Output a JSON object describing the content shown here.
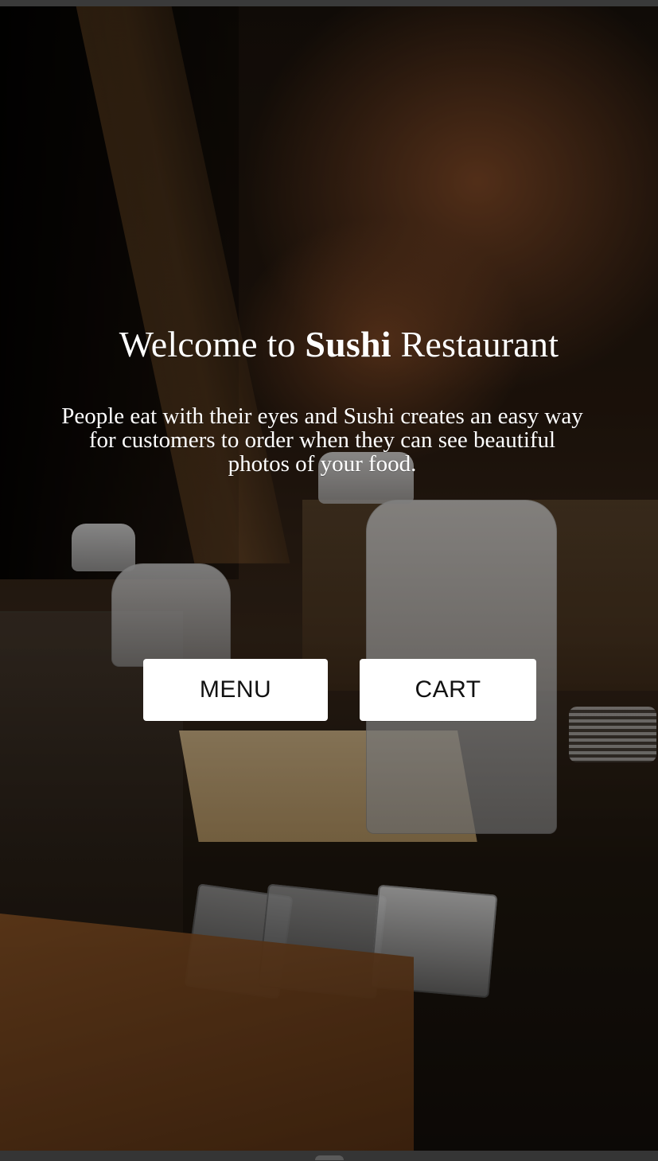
{
  "hero": {
    "title_prefix": "Welcome to ",
    "title_brand": "Sushi",
    "title_suffix": " Restaurant",
    "subtitle": "People eat with their eyes and Sushi creates an easy way for customers to order when they can see beautiful photos of your food."
  },
  "actions": {
    "menu_label": "MENU",
    "cart_label": "CART"
  }
}
